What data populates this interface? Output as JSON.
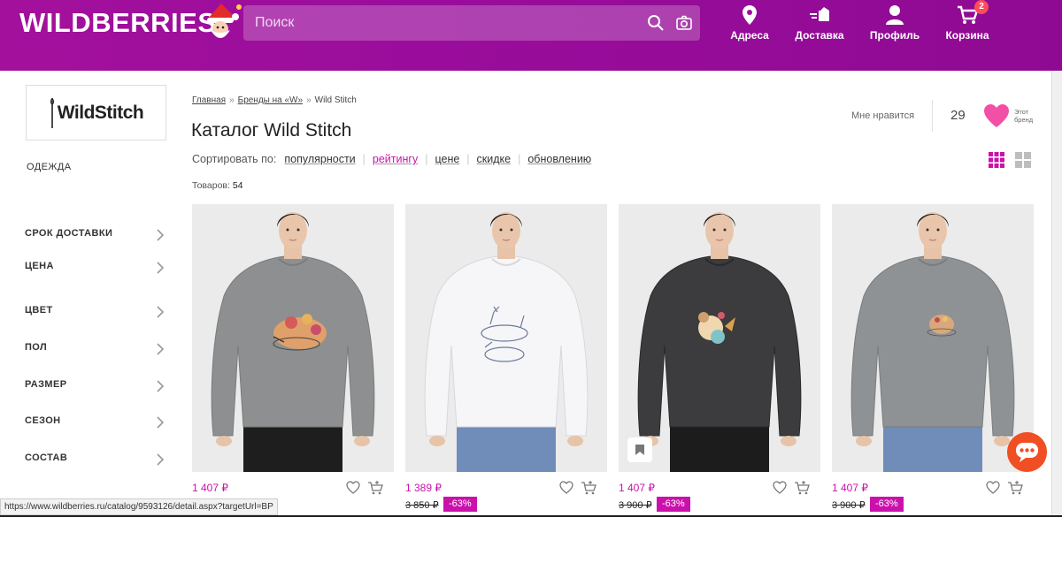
{
  "header": {
    "logo": "WILDBERRIES",
    "search_placeholder": "Поиск",
    "nav": [
      {
        "label": "Адреса",
        "icon": "map-pin-icon"
      },
      {
        "label": "Доставка",
        "icon": "delivery-icon"
      },
      {
        "label": "Профиль",
        "icon": "profile-icon"
      },
      {
        "label": "Корзина",
        "icon": "cart-icon",
        "badge": "2"
      }
    ],
    "colors": {
      "brand": "#a3109c",
      "accent": "#cb11ab",
      "badge": "#ff4b5c"
    }
  },
  "sidebar": {
    "brand_logo_text": "WildStitch",
    "category": "ОДЕЖДА",
    "filters": [
      "СРОК ДОСТАВКИ",
      "ЦЕНА",
      "ЦВЕТ",
      "ПОЛ",
      "РАЗМЕР",
      "СЕЗОН",
      "СОСТАВ"
    ]
  },
  "main": {
    "breadcrumb": [
      {
        "label": "Главная",
        "link": true
      },
      {
        "label": "Бренды на «W»",
        "link": true
      },
      {
        "label": "Wild Stitch",
        "link": false
      }
    ],
    "breadcrumb_sep": "»",
    "title": "Каталог Wild Stitch",
    "sort_label": "Сортировать по:",
    "sort_options": [
      {
        "label": "популярности",
        "active": false
      },
      {
        "label": "рейтингу",
        "active": true
      },
      {
        "label": "цене",
        "active": false
      },
      {
        "label": "скидке",
        "active": false
      },
      {
        "label": "обновлению",
        "active": false
      }
    ],
    "count_label": "Товаров:",
    "count_value": "54",
    "like_label": "Мне нравится",
    "like_count": "29",
    "brand_label_1": "Этот",
    "brand_label_2": "бренд"
  },
  "products": [
    {
      "price": "1 407 ₽",
      "old_price": "",
      "discount": "",
      "sweater_color": "#8d8f90",
      "print": "hedgehog"
    },
    {
      "price": "1 389 ₽",
      "old_price": "3 850 ₽",
      "discount": "-63%",
      "sweater_color": "#f6f6f8",
      "print": "deer"
    },
    {
      "price": "1 407 ₽",
      "old_price": "3 900 ₽",
      "discount": "-63%",
      "sweater_color": "#3c3c3e",
      "print": "bird",
      "bookmark": true
    },
    {
      "price": "1 407 ₽",
      "old_price": "3 900 ₽",
      "discount": "-63%",
      "sweater_color": "#8f9294",
      "print": "hedgehog-small"
    }
  ],
  "status_url": "https://www.wildberries.ru/catalog/9593126/detail.aspx?targetUrl=BP"
}
